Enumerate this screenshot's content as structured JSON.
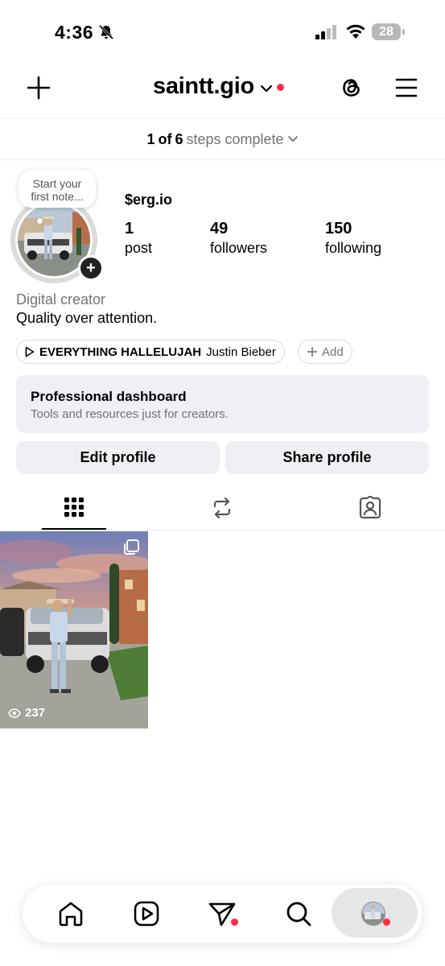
{
  "status_bar": {
    "time": "4:36",
    "battery": "28"
  },
  "header": {
    "username": "saintt.gio"
  },
  "steps": {
    "done": "1",
    "of": "of",
    "total": "6",
    "rest": "steps complete"
  },
  "note": {
    "line1": "Start your",
    "line2": "first note..."
  },
  "profile": {
    "display_name": "$erg.io",
    "stats": [
      {
        "num": "1",
        "label": "post"
      },
      {
        "num": "49",
        "label": "followers"
      },
      {
        "num": "150",
        "label": "following"
      }
    ],
    "category": "Digital creator",
    "bio": "Quality over attention."
  },
  "music": {
    "song": "EVERYTHING HALLELUJAH",
    "artist": "Justin Bieber",
    "add_label": "Add"
  },
  "dashboard": {
    "title": "Professional dashboard",
    "subtitle": "Tools and resources just for creators."
  },
  "buttons": {
    "edit": "Edit profile",
    "share": "Share profile"
  },
  "posts": [
    {
      "views": "237"
    }
  ],
  "colors": {
    "accent_red": "#ff2d46",
    "button_bg": "#efeff4",
    "muted": "#737373"
  },
  "icons": {
    "header": [
      "plus-icon",
      "chevron-down-icon",
      "threads-icon",
      "menu-icon"
    ],
    "tabs": [
      "grid-icon",
      "reels-repost-icon",
      "tagged-icon"
    ],
    "nav": [
      "home-icon",
      "reels-icon",
      "send-icon",
      "search-icon",
      "profile-avatar"
    ]
  }
}
